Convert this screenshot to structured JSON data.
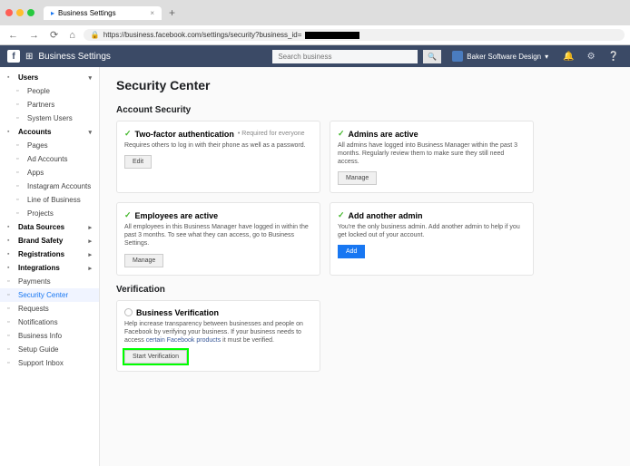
{
  "browser": {
    "tab_title": "Business Settings",
    "url_prefix": "https://business.facebook.com/settings/security?business_id="
  },
  "header": {
    "title": "Business Settings",
    "search_placeholder": "Search business",
    "org_name": "Baker Software Design"
  },
  "sidebar": {
    "sections": [
      {
        "label": "Users",
        "expanded": true,
        "items": [
          {
            "label": "People"
          },
          {
            "label": "Partners"
          },
          {
            "label": "System Users"
          }
        ]
      },
      {
        "label": "Accounts",
        "expanded": true,
        "items": [
          {
            "label": "Pages"
          },
          {
            "label": "Ad Accounts"
          },
          {
            "label": "Apps"
          },
          {
            "label": "Instagram Accounts"
          },
          {
            "label": "Line of Business"
          },
          {
            "label": "Projects"
          }
        ]
      },
      {
        "label": "Data Sources",
        "arrow": true
      },
      {
        "label": "Brand Safety",
        "arrow": true
      },
      {
        "label": "Registrations",
        "arrow": true
      },
      {
        "label": "Integrations",
        "arrow": true
      }
    ],
    "flat": [
      {
        "label": "Payments"
      },
      {
        "label": "Security Center",
        "active": true
      },
      {
        "label": "Requests"
      },
      {
        "label": "Notifications"
      },
      {
        "label": "Business Info"
      },
      {
        "label": "Setup Guide"
      },
      {
        "label": "Support Inbox"
      }
    ]
  },
  "main": {
    "title": "Security Center",
    "section1": "Account Security",
    "cards1": [
      {
        "title": "Two-factor authentication",
        "req": "• Required for everyone",
        "body": "Requires others to log in with their phone as well as a password.",
        "btn": "Edit",
        "check": true
      },
      {
        "title": "Admins are active",
        "body": "All admins have logged into Business Manager within the past 3 months. Regularly review them to make sure they still need access.",
        "btn": "Manage",
        "check": true
      },
      {
        "title": "Employees are active",
        "body": "All employees in this Business Manager have logged in within the past 3 months. To see what they can access, go to Business Settings.",
        "btn": "Manage",
        "check": true
      },
      {
        "title": "Add another admin",
        "body": "You're the only business admin. Add another admin to help if you get locked out of your account.",
        "btn": "Add",
        "blue": true,
        "check": true
      }
    ],
    "section2": "Verification",
    "verify": {
      "title": "Business Verification",
      "body": "Help increase transparency between businesses and people on Facebook by verifying your business. If your business needs to access ",
      "link": "certain Facebook products",
      "body2": " it must be verified.",
      "btn": "Start Verification"
    }
  }
}
